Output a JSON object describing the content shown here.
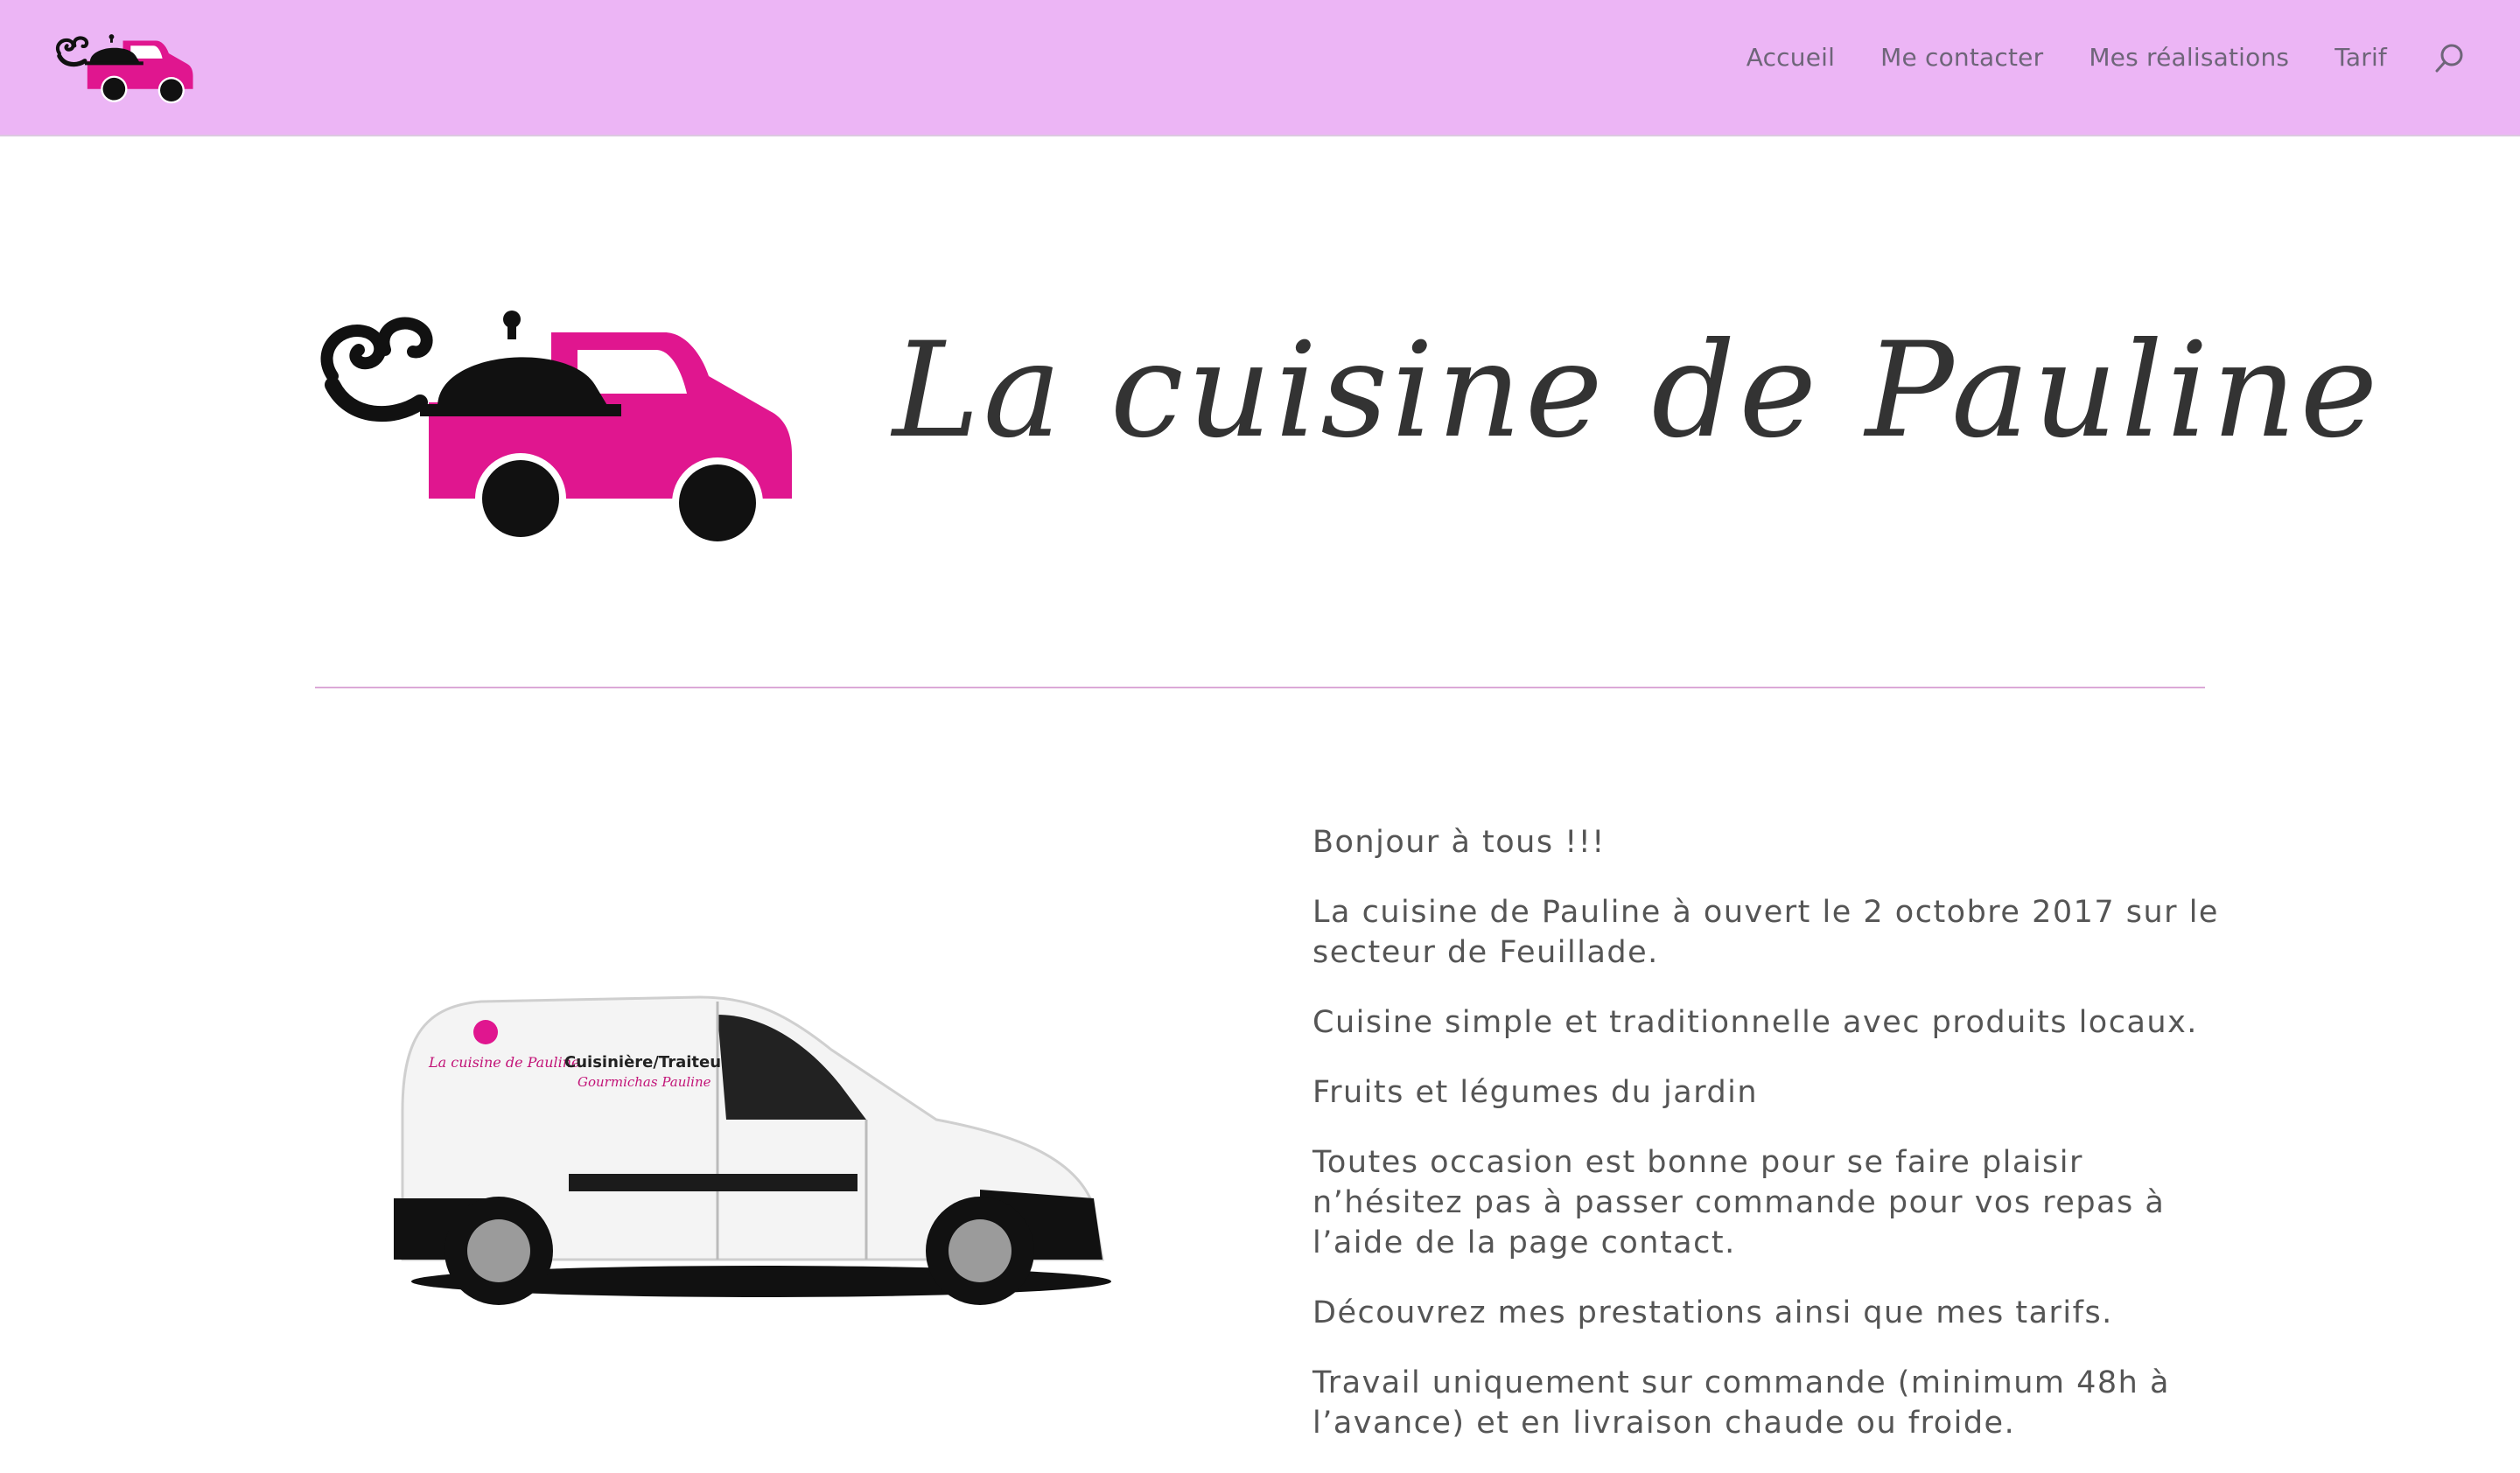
{
  "header": {
    "background_color": "#ecb5f5",
    "logo_icon": "food-truck-logo-icon",
    "nav": [
      {
        "label": "Accueil"
      },
      {
        "label": "Me contacter"
      },
      {
        "label": "Mes réalisations"
      },
      {
        "label": "Tarif"
      }
    ],
    "search_icon": "search-icon"
  },
  "hero": {
    "title": "La cuisine de Pauline",
    "logo_icon": "food-truck-logo-icon",
    "brand_pink": "#e0168f",
    "divider_color": "#dba9d7"
  },
  "main": {
    "van_image": "delivery-van-image",
    "van_label_brand": "La cuisine de Pauline",
    "van_label_role": "Cuisinière/Traiteur",
    "van_label_name": "Gourmichas Pauline",
    "paragraphs": [
      "Bonjour à tous !!!",
      "La cuisine de Pauline à ouvert le 2 octobre 2017 sur le secteur de Feuillade.",
      "Cuisine simple et traditionnelle avec produits locaux.",
      "Fruits et légumes du jardin",
      "Toutes occasion est bonne pour se faire plaisir n’hésitez pas à passer commande pour vos repas à l’aide de la page contact.",
      "Découvrez mes prestations ainsi que mes tarifs.",
      "Travail uniquement sur commande (minimum 48h à l’avance) et en livraison chaude ou froide."
    ]
  }
}
